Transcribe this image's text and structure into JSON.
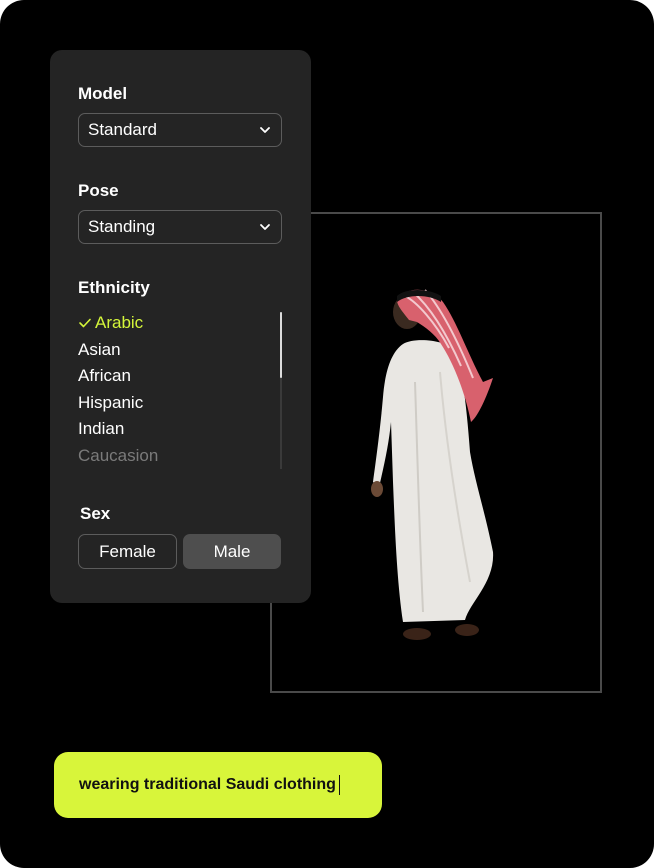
{
  "panel": {
    "model": {
      "label": "Model",
      "value": "Standard",
      "icon": "chevron-down-icon"
    },
    "pose": {
      "label": "Pose",
      "value": "Standing",
      "icon": "chevron-down-icon"
    },
    "ethnicity": {
      "label": "Ethnicity",
      "items": [
        "Arabic",
        "Asian",
        "African",
        "Hispanic",
        "Indian",
        "Caucasion"
      ],
      "selected": "Arabic",
      "check_icon": "check-icon"
    },
    "sex": {
      "label": "Sex",
      "options": [
        "Female",
        "Male"
      ],
      "selected": "Male"
    }
  },
  "prompt": {
    "text": "wearing traditional Saudi clothing"
  },
  "colors": {
    "background": "#000000",
    "panel": "#242424",
    "accent": "#d8f53a",
    "selected_text": "#d4f53a"
  }
}
